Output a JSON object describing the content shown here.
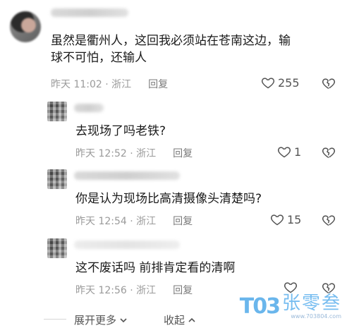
{
  "comments": [
    {
      "text_line1": "虽然是衢州人，这回我必须站在苍南这边，输",
      "text_line2": "球不可怕，还输人",
      "time": "昨天 11:02 · 浙江",
      "reply_label": "回复",
      "likes": "255"
    },
    {
      "text": "去现场了吗老铁?",
      "time": "昨天 12:52 · 浙江",
      "reply_label": "回复",
      "likes": "1"
    },
    {
      "text": "你是认为现场比高清摄像头清楚吗?",
      "time": "昨天 12:54 · 浙江",
      "reply_label": "回复",
      "likes": "15"
    },
    {
      "text": "这不废话吗 前排肯定看的清啊",
      "time": "昨天 12:56 · 浙江",
      "reply_label": "回复",
      "likes": ""
    }
  ],
  "footer": {
    "expand_label": "展开更多",
    "collapse_label": "收起"
  },
  "watermark": {
    "mark": "T03",
    "name": "张零叁",
    "url": "www.703804.com"
  },
  "icons": {
    "like": "heart-outline-icon",
    "dislike": "broken-heart-icon",
    "expand": "chevron-down-icon",
    "collapse": "chevron-up-icon"
  }
}
